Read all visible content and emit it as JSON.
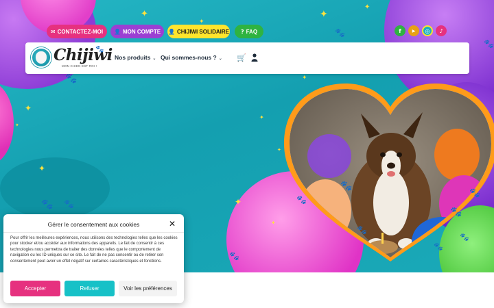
{
  "top_buttons": {
    "contact": "CONTACTEZ-MOI",
    "account": "MON COMPTE",
    "solidaire": "CHIJIWI SOLIDAIRE",
    "faq": "FAQ"
  },
  "social": {
    "facebook": "f",
    "youtube": "▶",
    "instagram": "◎",
    "tiktok": "♪"
  },
  "logo": {
    "name": "Chijiwi",
    "tagline": "MON CHIEN EST ROI !"
  },
  "nav": {
    "products": "Nos produits",
    "about": "Qui sommes-nous ?"
  },
  "cookie": {
    "title": "Gérer le consentement aux cookies",
    "close": "✕",
    "text": "Pour offrir les meilleures expériences, nous utilisons des technologies telles que les cookies pour stocker et/ou accéder aux informations des appareils. Le fait de consentir à ces technologies nous permettra de traiter des données telles que le comportement de navigation ou les ID uniques sur ce site. Le fait de ne pas consentir ou de retirer son consentement peut avoir un effet négatif sur certaines caractéristiques et fonctions.",
    "accept": "Accepter",
    "refuse": "Refuser",
    "preferences": "Voir les préférences"
  },
  "icons": {
    "envelope": "envelope-icon",
    "user": "user-icon",
    "solidarity": "solidarity-user-icon",
    "question": "question-icon",
    "cart": "cart-icon",
    "caret": "chevron-down-icon"
  },
  "colors": {
    "pink": "#e6317f",
    "purple": "#9b3fd3",
    "yellow": "#ffe52c",
    "green": "#2fb341",
    "teal": "#17c1c7",
    "orange_frame": "#ff9b1a"
  }
}
